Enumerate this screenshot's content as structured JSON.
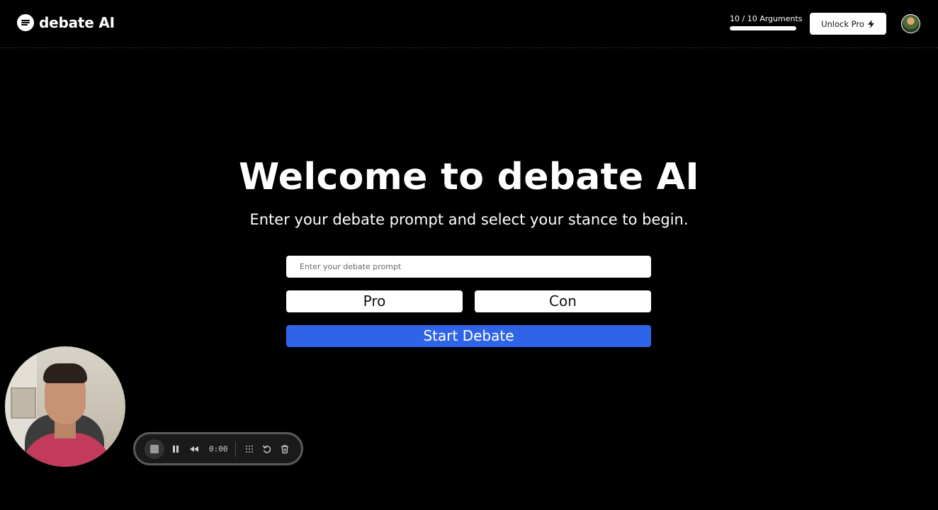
{
  "header": {
    "logo_text": "debate AI",
    "usage": {
      "label": "10 / 10 Arguments",
      "used": 10,
      "total": 10
    },
    "unlock_label": "Unlock Pro",
    "unlock_icon": "lightning-bolt-icon",
    "avatar_icon": "user-avatar"
  },
  "main": {
    "title": "Welcome to debate AI",
    "subtitle": "Enter your debate prompt and select your stance to begin.",
    "prompt_placeholder": "Enter your debate prompt",
    "prompt_value": "",
    "stance_pro_label": "Pro",
    "stance_con_label": "Con",
    "start_label": "Start Debate"
  },
  "recorder": {
    "time": "0:00",
    "icons": [
      "stop-icon",
      "pause-icon",
      "rewind-icon",
      "grid-icon",
      "restart-icon",
      "trash-icon"
    ]
  },
  "colors": {
    "background": "#000000",
    "accent_blue": "#2f64e9",
    "button_white": "#ffffff"
  }
}
